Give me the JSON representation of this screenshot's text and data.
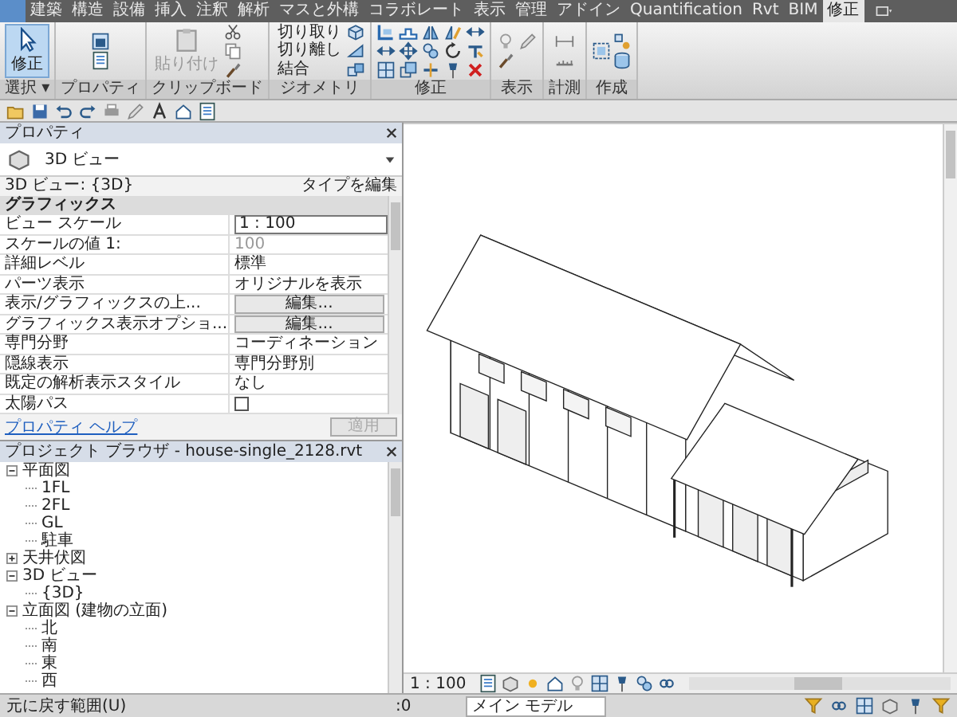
{
  "ribbon": {
    "tabs": [
      {
        "label": "建築",
        "selected": false
      },
      {
        "label": "構造",
        "selected": false
      },
      {
        "label": "設備",
        "selected": false
      },
      {
        "label": "挿入",
        "selected": false
      },
      {
        "label": "注釈",
        "selected": false
      },
      {
        "label": "解析",
        "selected": false
      },
      {
        "label": "マスと外構",
        "selected": false
      },
      {
        "label": "コラボレート",
        "selected": false
      },
      {
        "label": "表示",
        "selected": false
      },
      {
        "label": "管理",
        "selected": false
      },
      {
        "label": "アドイン",
        "selected": false
      },
      {
        "label": "Quantification",
        "selected": false
      },
      {
        "label": "Rvt",
        "selected": false
      },
      {
        "label": "BIM",
        "selected": false
      },
      {
        "label": "修正",
        "selected": true
      }
    ],
    "modify_button": "修正",
    "paste_button": "貼り付け",
    "geometry_items": [
      "切り取り",
      "切り離し",
      "結合"
    ],
    "panels": [
      "選択 ▾",
      "プロパティ",
      "クリップボード",
      "ジオメトリ",
      "修正",
      "表示",
      "計測",
      "作成"
    ]
  },
  "properties": {
    "title": "プロパティ",
    "type_name": "3D ビュー",
    "instance": "3D ビュー: {3D}",
    "edit_type": "タイプを編集",
    "group": "グラフィックス",
    "rows": [
      {
        "kind": "input",
        "name": "ビュー スケール",
        "value": "1 : 100"
      },
      {
        "kind": "disabled",
        "name": "スケールの値 1:",
        "value": "100"
      },
      {
        "kind": "text",
        "name": "詳細レベル",
        "value": "標準"
      },
      {
        "kind": "text",
        "name": "パーツ表示",
        "value": "オリジナルを表示"
      },
      {
        "kind": "button",
        "name": "表示/グラフィックスの上...",
        "value": "編集..."
      },
      {
        "kind": "button",
        "name": "グラフィックス表示オプショ...",
        "value": "編集..."
      },
      {
        "kind": "text",
        "name": "専門分野",
        "value": "コーディネーション"
      },
      {
        "kind": "text",
        "name": "隠線表示",
        "value": "専門分野別"
      },
      {
        "kind": "text",
        "name": "既定の解析表示スタイル",
        "value": "なし"
      },
      {
        "kind": "checkbox",
        "name": "太陽パス",
        "checked": false
      }
    ],
    "help_link": "プロパティ ヘルプ",
    "apply_button": "適用",
    "apply_disabled": true
  },
  "browser": {
    "title": "プロジェクト ブラウザ - house-single_2128.rvt",
    "tree": [
      {
        "label": "平面図",
        "expanded": true,
        "children": [
          {
            "label": "1FL"
          },
          {
            "label": "2FL"
          },
          {
            "label": "GL"
          },
          {
            "label": "駐車"
          }
        ]
      },
      {
        "label": "天井伏図",
        "expanded": false
      },
      {
        "label": "3D ビュー",
        "expanded": true,
        "children": [
          {
            "label": "{3D}"
          }
        ]
      },
      {
        "label": "立面図 (建物の立面)",
        "expanded": true,
        "children": [
          {
            "label": "北"
          },
          {
            "label": "南"
          },
          {
            "label": "東"
          },
          {
            "label": "西"
          }
        ]
      }
    ]
  },
  "view": {
    "scale": "1 : 100"
  },
  "status_bar": {
    "message": "元に戻す範囲(U)",
    "count": ":0",
    "model": "メイン モデル"
  }
}
